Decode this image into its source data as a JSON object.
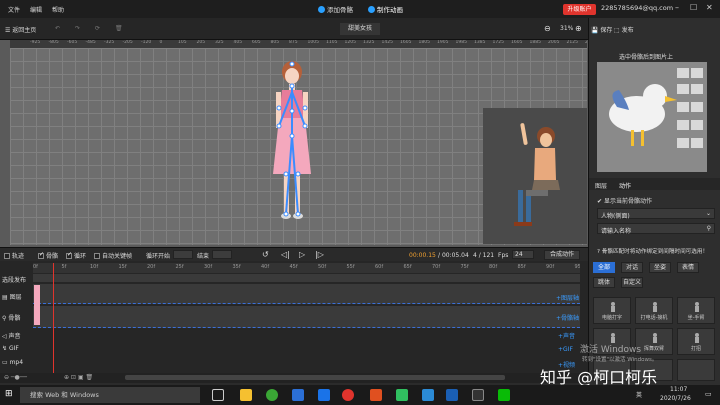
{
  "menubar": {
    "menus": [
      "文件",
      "编辑",
      "帮助"
    ],
    "modes": [
      {
        "label": "添加骨骼",
        "active": false
      },
      {
        "label": "制作动画",
        "active": true
      }
    ],
    "upgrade_label": "升级账户",
    "account": "2285785694@qq.com",
    "window_controls": [
      "minimize-icon",
      "maximize-icon",
      "close-icon"
    ]
  },
  "toolbar": {
    "back_label": "返回主页",
    "scene_name": "甜美女孩",
    "zoom": "31%",
    "save_label": "保存",
    "publish_label": "发布"
  },
  "ruler_ticks": [
    "-925",
    "-805",
    "-605",
    "-485",
    "-325",
    "-205",
    "-120",
    "0",
    "105",
    "205",
    "325",
    "405",
    "605",
    "805",
    "875",
    "1005",
    "1105",
    "1205",
    "1325",
    "1425",
    "1605",
    "1805",
    "1905",
    "1985",
    "1385",
    "1725",
    "1605",
    "1885",
    "2005",
    "2125",
    "2225",
    "2365"
  ],
  "right_panel": {
    "hint": "选中骨骼后到图片上",
    "tabs": [
      "图层",
      "动作"
    ],
    "show_current_action_label": "显示当前骨骼动作",
    "dropdown_value": "人物(侧面)",
    "search_placeholder": "请输入名称",
    "notice": "骨骼匹配时将动作绑定到间隔时间可选用！",
    "categories": [
      "全部",
      "对话",
      "坐姿",
      "表情",
      "跳体",
      "自定义"
    ],
    "actions": [
      "电脑打字",
      "打电话-接机",
      "坐-手臂",
      "",
      "挥舞双臂",
      "打招"
    ]
  },
  "controls": {
    "track_label": "轨迹",
    "bone_label": "骨骼",
    "loop_label": "循环",
    "auto_keyframe_label": "自动关键帧",
    "loop_start_label": "循环开始",
    "end_label": "结束",
    "time_current": "00:00.15",
    "time_total": "00:05.04",
    "frame_current": "4",
    "frame_total": "121",
    "fps_label": "Fps",
    "fps_value": "24",
    "export_label": "合成动作"
  },
  "timeline": {
    "ticks": [
      "0f",
      "5f",
      "10f",
      "15f",
      "20f",
      "25f",
      "30f",
      "35f",
      "40f",
      "45f",
      "50f",
      "55f",
      "60f",
      "65f",
      "70f",
      "75f",
      "80f",
      "85f",
      "90f",
      "95f"
    ],
    "tracks": [
      {
        "label": "选段发布",
        "link": ""
      },
      {
        "label": "图层",
        "link": "+图层轴"
      },
      {
        "label": "骨骼",
        "link": "+骨骼轴"
      },
      {
        "label": "声音",
        "link": "+声音"
      },
      {
        "label": "GIF",
        "link": "+GIF"
      },
      {
        "label": "mp4",
        "link": "+视频"
      }
    ]
  },
  "watermark": {
    "activate_windows": "激活 Windows",
    "activate_hint": "转到\"设置\"以激活 Windows。",
    "zhihu": "知乎 @柯口柯乐"
  },
  "taskbar": {
    "search_placeholder": "搜索 Web 和 Windows",
    "time": "11:07",
    "date": "2020/7/26",
    "ime": "英"
  },
  "colors": {
    "accent_blue": "#2b6fd6",
    "upgrade_red": "#e0342d",
    "time_orange": "#f0a030"
  }
}
